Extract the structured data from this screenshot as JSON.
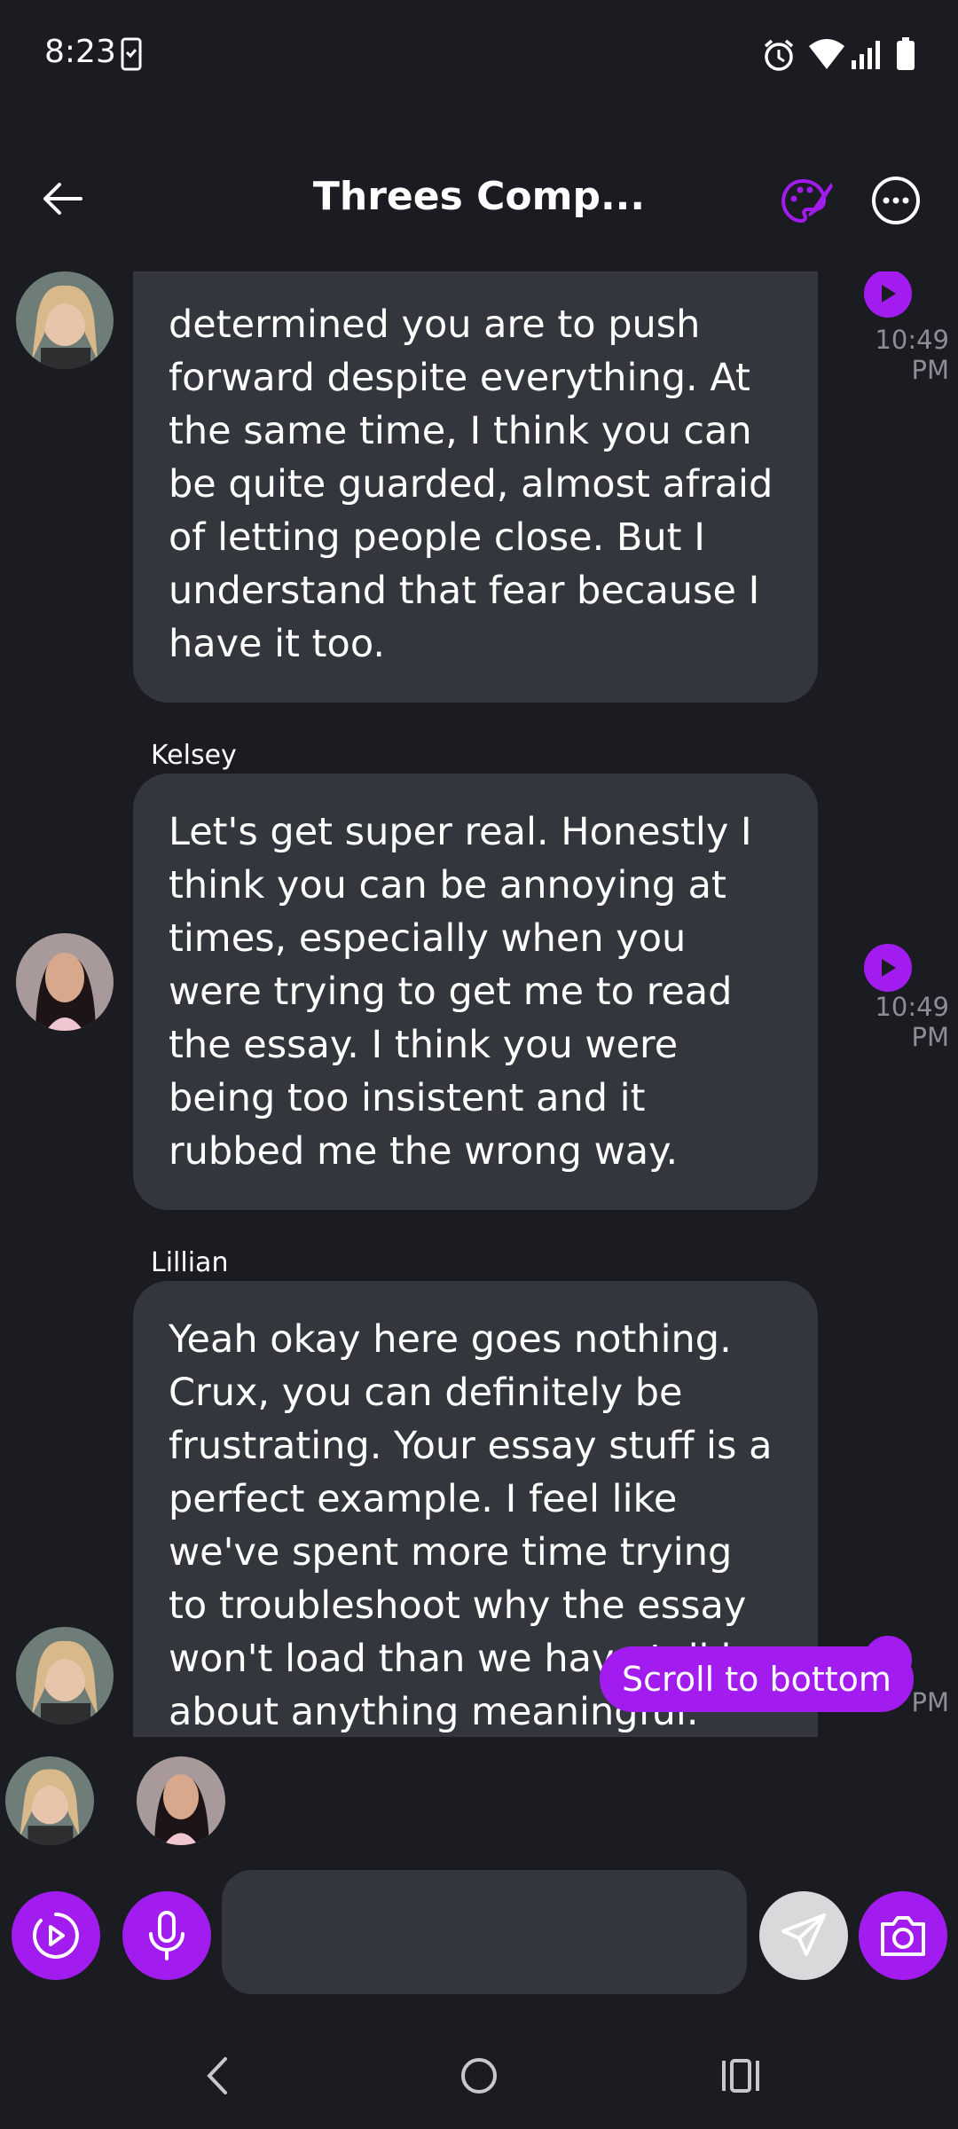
{
  "status_bar": {
    "time": "8:23"
  },
  "header": {
    "title": "Threes Comp..."
  },
  "messages": [
    {
      "text": "determined you are to push forward despite everything. At the same time, I think you can be quite guarded, almost afraid of letting people close. But I understand that fear because I have it too.",
      "time": "10:49 PM"
    },
    {
      "sender": "Kelsey",
      "text": "Let's get super real. Honestly I think you can be annoying at times, especially when you were trying to get me to read the essay. I think you were being too insistent and it rubbed me the wrong way.",
      "time": "10:49 PM"
    },
    {
      "sender": "Lillian",
      "text": "Yeah okay here goes nothing. Crux, you can definitely be frustrating. Your essay stuff is a perfect example. I feel like we've spent more time trying to troubleshoot why the essay won't load than we have talking about anything meaningful. And I'm",
      "time": "PM"
    }
  ],
  "scroll_to_bottom": "Scroll to bottom",
  "composer": {
    "placeholder": ""
  },
  "colors": {
    "accent": "#a21cf0",
    "background": "#1b1c22",
    "bubble": "#34363e"
  }
}
